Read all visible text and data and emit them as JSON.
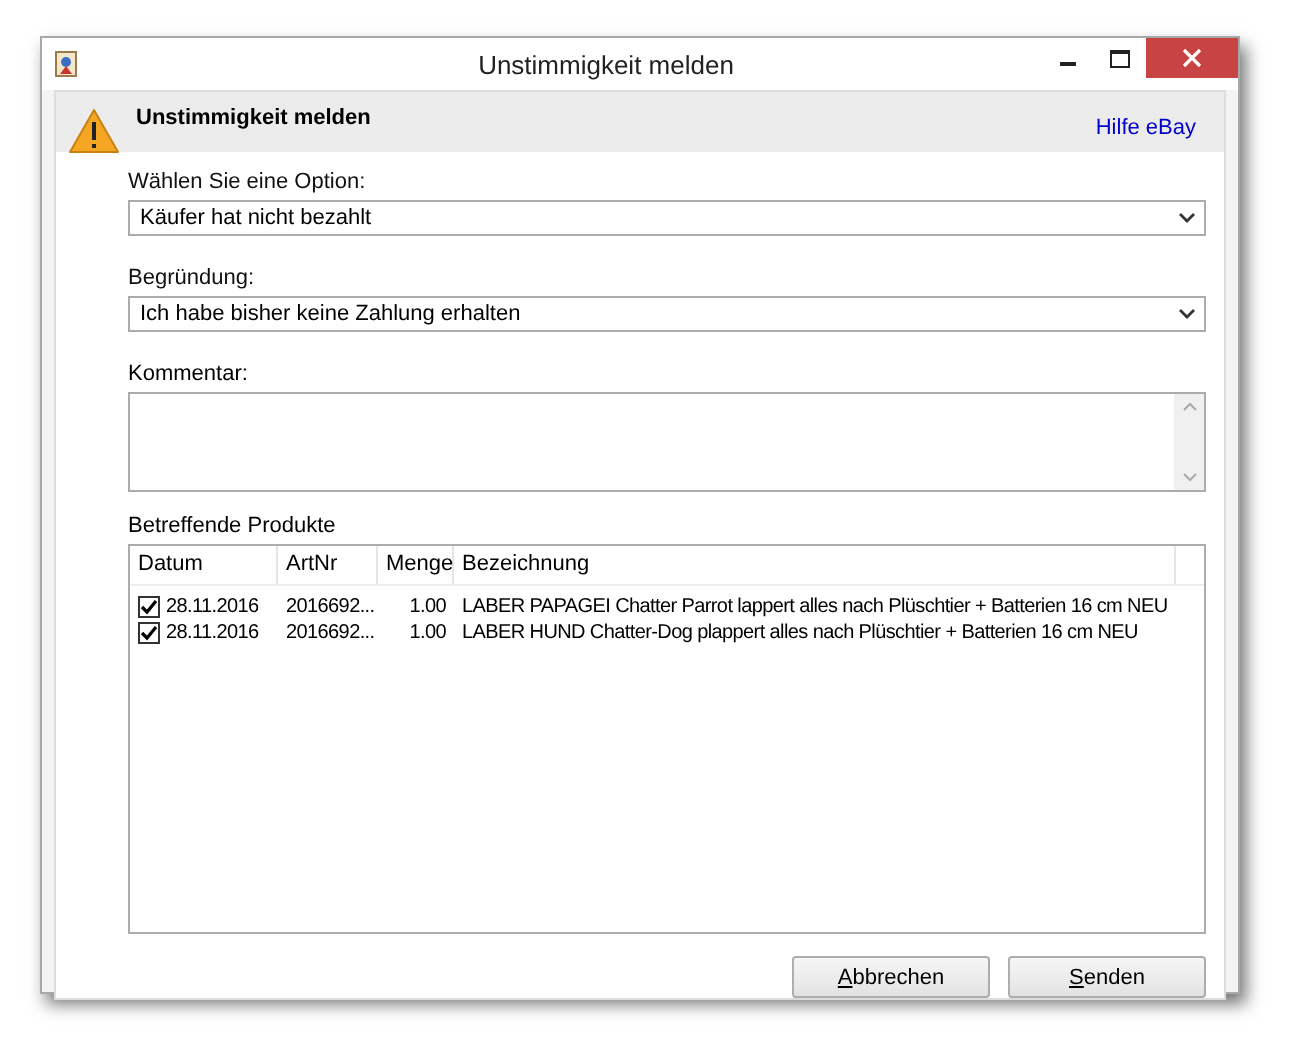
{
  "window": {
    "title": "Unstimmigkeit melden"
  },
  "header": {
    "title": "Unstimmigkeit melden",
    "help_link": "Hilfe eBay"
  },
  "option": {
    "label": "Wählen Sie eine Option:",
    "value": "Käufer hat nicht bezahlt"
  },
  "reason": {
    "label": "Begründung:",
    "value": "Ich habe bisher keine Zahlung erhalten"
  },
  "comment": {
    "label": "Kommentar:"
  },
  "products": {
    "label": "Betreffende Produkte",
    "columns": [
      "Datum",
      "ArtNr",
      "Menge",
      "Bezeichnung"
    ],
    "rows": [
      {
        "checked": true,
        "date": "28.11.2016",
        "artnr": "2016692...",
        "qty": "1.00",
        "name": "LABER PAPAGEI Chatter Parrot lappert alles nach Plüschtier + Batterien 16 cm NEU"
      },
      {
        "checked": true,
        "date": "28.11.2016",
        "artnr": "2016692...",
        "qty": "1.00",
        "name": "LABER HUND Chatter-Dog plappert alles nach Plüschtier + Batterien 16 cm NEU"
      }
    ]
  },
  "buttons": [
    {
      "label": "Abbrechen",
      "underlined_initial": true
    },
    {
      "label": "Senden",
      "underlined_initial": true
    }
  ]
}
